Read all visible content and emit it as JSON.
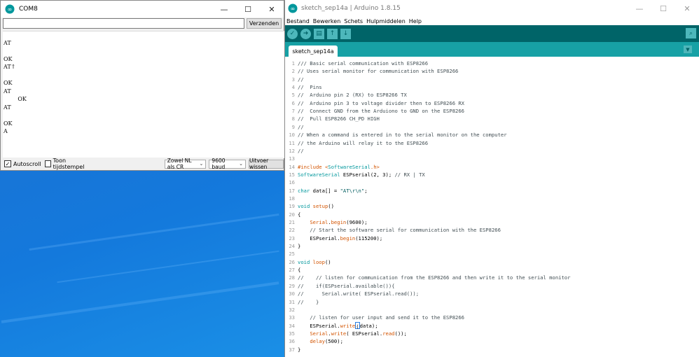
{
  "serial_monitor": {
    "title": "COM8",
    "input_value": "",
    "send_label": "Verzenden",
    "output_lines": [
      "AT",
      "",
      "OK",
      "AT↑",
      "",
      "OK",
      "AT",
      "        OK",
      "",
      "AT",
      "",
      "OK",
      "A"
    ],
    "autoscroll_label": "Autoscroll",
    "autoscroll_checked": true,
    "timestamp_label": "Toon tijdstempel",
    "timestamp_checked": false,
    "line_ending": "Zowel NL als CR",
    "baud": "9600 baud",
    "clear_label": "Uitvoer wissen"
  },
  "ide": {
    "title": "sketch_sep14a | Arduino 1.8.15",
    "menu": [
      "Bestand",
      "Bewerken",
      "Schets",
      "Hulpmiddelen",
      "Help"
    ],
    "tab": "sketch_sep14a",
    "code": [
      [
        {
          "t": "/// Basic serial communication with ESP8266",
          "c": "comment"
        }
      ],
      [
        {
          "t": "// Uses serial monitor for communication with ESP8266",
          "c": "comment"
        }
      ],
      [
        {
          "t": "//",
          "c": "comment"
        }
      ],
      [
        {
          "t": "//  Pins",
          "c": "comment"
        }
      ],
      [
        {
          "t": "//  Arduino pin 2 (RX) to ESP8266 TX",
          "c": "comment"
        }
      ],
      [
        {
          "t": "//  Arduino pin 3 to voltage divider then to ESP8266 RX",
          "c": "comment"
        }
      ],
      [
        {
          "t": "//  Connect GND from the Arduiono to GND on the ESP8266",
          "c": "comment"
        }
      ],
      [
        {
          "t": "//  Pull ESP8266 CH_PD HIGH",
          "c": "comment"
        }
      ],
      [
        {
          "t": "//",
          "c": "comment"
        }
      ],
      [
        {
          "t": "// When a command is entered in to the serial monitor on the computer",
          "c": "comment"
        }
      ],
      [
        {
          "t": "// the Arduino will relay it to the ESP8266",
          "c": "comment"
        }
      ],
      [
        {
          "t": "//",
          "c": "comment"
        }
      ],
      [],
      [
        {
          "t": "#include <",
          "c": "kw"
        },
        {
          "t": "SoftwareSerial",
          "c": "type"
        },
        {
          "t": ".h>",
          "c": "kw"
        }
      ],
      [
        {
          "t": "SoftwareSerial",
          "c": "type"
        },
        {
          "t": " ESPserial(2, 3); ",
          "c": "plain"
        },
        {
          "t": "// RX | TX",
          "c": "comment"
        }
      ],
      [],
      [
        {
          "t": "char",
          "c": "type"
        },
        {
          "t": " data[] = ",
          "c": "plain"
        },
        {
          "t": "\"AT\\r\\n\"",
          "c": "str"
        },
        {
          "t": ";",
          "c": "plain"
        }
      ],
      [],
      [
        {
          "t": "void",
          "c": "type"
        },
        {
          "t": " ",
          "c": "plain"
        },
        {
          "t": "setup",
          "c": "kw"
        },
        {
          "t": "()",
          "c": "plain"
        }
      ],
      [
        {
          "t": "{",
          "c": "plain"
        }
      ],
      [
        {
          "t": "    ",
          "c": "plain"
        },
        {
          "t": "Serial",
          "c": "kw"
        },
        {
          "t": ".",
          "c": "plain"
        },
        {
          "t": "begin",
          "c": "kw"
        },
        {
          "t": "(9600);",
          "c": "plain"
        }
      ],
      [
        {
          "t": "    // Start the software serial for communication with the ESP8266",
          "c": "comment"
        }
      ],
      [
        {
          "t": "    ESPserial.",
          "c": "plain"
        },
        {
          "t": "begin",
          "c": "kw"
        },
        {
          "t": "(115200);",
          "c": "plain"
        }
      ],
      [
        {
          "t": "}",
          "c": "plain"
        }
      ],
      [],
      [
        {
          "t": "void",
          "c": "type"
        },
        {
          "t": " ",
          "c": "plain"
        },
        {
          "t": "loop",
          "c": "kw"
        },
        {
          "t": "()",
          "c": "plain"
        }
      ],
      [
        {
          "t": "{",
          "c": "plain"
        }
      ],
      [
        {
          "t": "//    // listen for communication from the ESP8266 and then write it to the serial monitor",
          "c": "comment"
        }
      ],
      [
        {
          "t": "//    if(ESPserial.available()){",
          "c": "comment"
        }
      ],
      [
        {
          "t": "//      Serial.write( ESPserial.read());",
          "c": "comment"
        }
      ],
      [
        {
          "t": "//    }",
          "c": "comment"
        }
      ],
      [],
      [
        {
          "t": "    // listen for user input and send it to the ESP8266",
          "c": "comment"
        }
      ],
      [
        {
          "t": "    ESPserial.",
          "c": "plain"
        },
        {
          "t": "write",
          "c": "kw"
        },
        {
          "t": "(",
          "c": "cursor"
        },
        {
          "t": "data);",
          "c": "plain"
        }
      ],
      [
        {
          "t": "    ",
          "c": "plain"
        },
        {
          "t": "Serial",
          "c": "kw"
        },
        {
          "t": ".",
          "c": "plain"
        },
        {
          "t": "write",
          "c": "kw"
        },
        {
          "t": "( ESPserial.",
          "c": "plain"
        },
        {
          "t": "read",
          "c": "kw"
        },
        {
          "t": "());",
          "c": "plain"
        }
      ],
      [
        {
          "t": "    ",
          "c": "plain"
        },
        {
          "t": "delay",
          "c": "kw"
        },
        {
          "t": "(500);",
          "c": "plain"
        }
      ],
      [
        {
          "t": "}",
          "c": "plain"
        }
      ]
    ]
  },
  "colors": {
    "ide_toolbar": "#006468",
    "ide_tabbar": "#17a1a5",
    "ide_button": "#4db7bb",
    "comment": "#434f54",
    "type": "#00979c",
    "keyword": "#d35400"
  }
}
